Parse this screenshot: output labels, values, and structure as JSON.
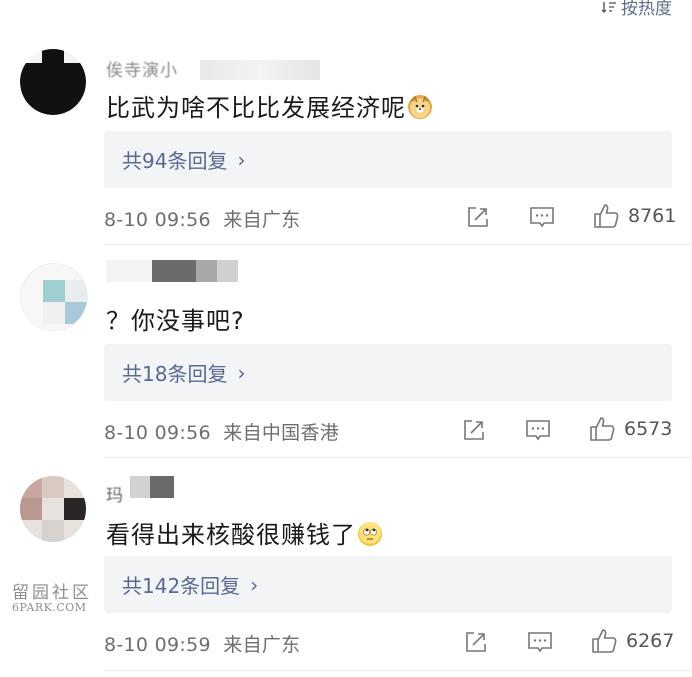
{
  "sort_label": "按热度",
  "comments": [
    {
      "username": "俟寺演小",
      "text": "比武为啥不比比发展经济呢",
      "emoji": "doge-emoji",
      "replies_label": "共94条回复",
      "date": "8-10 09:56",
      "location": "来自广东",
      "likes": "8761"
    },
    {
      "username": "",
      "text": "？你没事吧?",
      "emoji": "",
      "replies_label": "共18条回复",
      "date": "8-10 09:56",
      "location": "来自中国香港",
      "likes": "6573"
    },
    {
      "username": "玛",
      "text": "看得出来核酸很赚钱了",
      "emoji": "eye-roll-emoji",
      "replies_label": "共142条回复",
      "date": "8-10 09:59",
      "location": "来自广东",
      "likes": "6267"
    }
  ],
  "watermark": {
    "line1": "留园社区",
    "line2": "6PARK.COM"
  },
  "colors": {
    "link": "#566a92",
    "reply_bg": "#f3f4f6",
    "meta": "#6f6f6f"
  }
}
